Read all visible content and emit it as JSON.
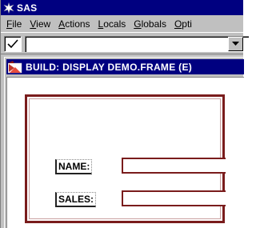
{
  "app": {
    "title": "SAS"
  },
  "menu": {
    "items": [
      {
        "key": "F",
        "rest": "ile"
      },
      {
        "key": "V",
        "rest": "iew"
      },
      {
        "key": "A",
        "rest": "ctions"
      },
      {
        "key": "L",
        "rest": "ocals"
      },
      {
        "key": "G",
        "rest": "lobals"
      },
      {
        "key": "O",
        "rest": "pti"
      }
    ]
  },
  "toolbar": {
    "check_icon": "checkmark-icon",
    "command_value": "",
    "dropdown_icon": "chevron-down-icon"
  },
  "child_window": {
    "title": "BUILD: DISPLAY DEMO.FRAME (E)",
    "icon": "build-frame-icon"
  },
  "form": {
    "name_label": "NAME:",
    "sales_label": "SALES:"
  },
  "colors": {
    "title_bar": "#000080",
    "frame_border": "#7a1c1c",
    "chrome": "#c0c0c0"
  }
}
